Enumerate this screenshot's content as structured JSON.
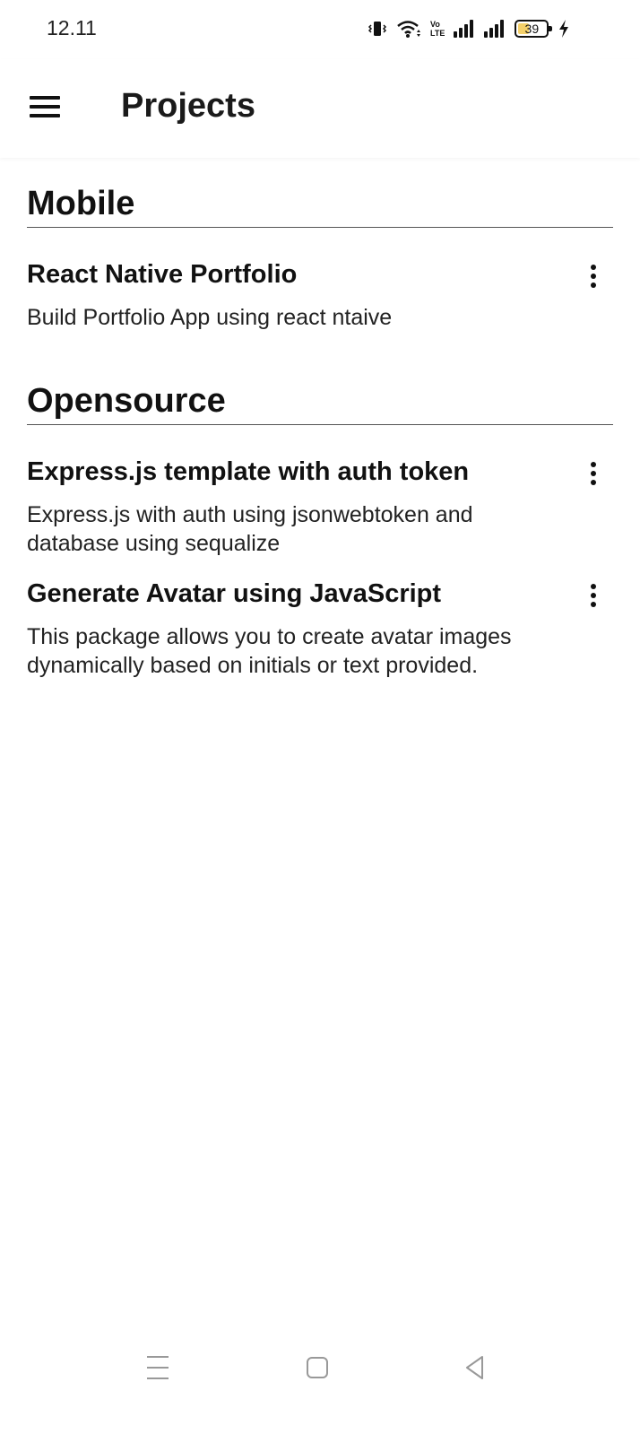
{
  "status_bar": {
    "time": "12.11",
    "volte_top": "Vo",
    "volte_bottom": "LTE",
    "battery_percent": "39",
    "battery_level": 0.39,
    "icons": [
      "vibrate-icon",
      "wifi-icon",
      "volte-icon",
      "signal-icon",
      "signal-icon",
      "battery-icon",
      "charging-icon"
    ]
  },
  "app_bar": {
    "menu_icon": "hamburger-menu-icon",
    "title": "Projects"
  },
  "sections": [
    {
      "title": "Mobile",
      "projects": [
        {
          "title": "React Native Portfolio",
          "description": "Build Portfolio App using react ntaive",
          "action_icon": "more-vertical-icon"
        }
      ]
    },
    {
      "title": "Opensource",
      "projects": [
        {
          "title": "Express.js template with auth token",
          "description": "Express.js with auth using jsonwebtoken and database using sequalize",
          "action_icon": "more-vertical-icon"
        },
        {
          "title": "Generate Avatar using JavaScript",
          "description": "This package allows you to create avatar images dynamically based on initials or text provided.",
          "action_icon": "more-vertical-icon"
        }
      ]
    }
  ],
  "nav_bar": {
    "icons": [
      "recent-apps-icon",
      "home-icon",
      "back-icon"
    ]
  }
}
